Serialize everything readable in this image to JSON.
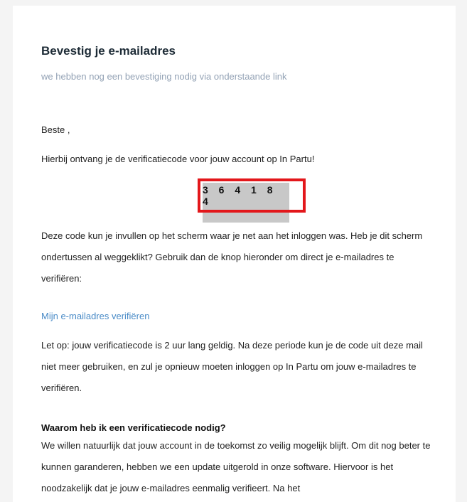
{
  "email": {
    "title": "Bevestig je e-mailadres",
    "subtitle": "we hebben nog een bevestiging nodig via onderstaande link",
    "greeting": "Beste ,",
    "intro": "Hierbij ontvang je de verificatiecode voor jouw account op In Partu!",
    "code": "3 6 4 1 8 4",
    "explain": "Deze code kun je invullen op het scherm waar je net aan het inloggen was. Heb je dit scherm ondertussen al weggeklikt? Gebruik dan de knop hieronder om direct je e-mailadres te verifiëren:",
    "verify_link": "Mijn e-mailadres verifiëren",
    "validity": "Let op: jouw verificatiecode is 2 uur lang geldig. Na deze periode kun je de code uit deze mail niet meer gebruiken, en zul je opnieuw moeten inloggen op In Partu om jouw e-mailadres te verifiëren.",
    "faq_title": "Waarom heb ik een verificatiecode nodig?",
    "faq_body": "We willen natuurlijk dat jouw account in de toekomst zo veilig mogelijk blijft. Om dit nog beter te kunnen garanderen, hebben we een update uitgerold in onze software. Hiervoor is het noodzakelijk dat je jouw e-mailadres eenmalig verifieert. Na het"
  },
  "colors": {
    "highlight_border": "#e3171b",
    "link": "#4a8bc7",
    "code_background": "#c8c8c8",
    "subtitle": "#93a2b5"
  }
}
